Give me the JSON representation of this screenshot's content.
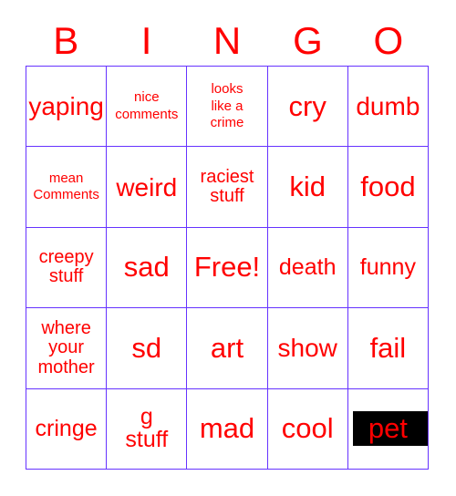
{
  "card": {
    "title": "BINGO",
    "header_letters": [
      "B",
      "I",
      "N",
      "G",
      "O"
    ],
    "colors": {
      "text": "#ff0000",
      "grid_border": "#6633ff",
      "cell_background": "#ffffff",
      "marked_highlight": "#000000",
      "page_background": "#ffffff"
    },
    "rows": [
      [
        {
          "label": "yaping",
          "size": "lg",
          "marked": false
        },
        {
          "label": "nice\ncomments",
          "size": "xs",
          "marked": false
        },
        {
          "label": "looks\nlike a\ncrime",
          "size": "xs",
          "marked": false
        },
        {
          "label": "cry",
          "size": "xl",
          "marked": false
        },
        {
          "label": "dumb",
          "size": "lg",
          "marked": false
        }
      ],
      [
        {
          "label": "mean\nComments",
          "size": "xs",
          "marked": false
        },
        {
          "label": "weird",
          "size": "lg",
          "marked": false
        },
        {
          "label": "raciest\nstuff",
          "size": "sm",
          "marked": false
        },
        {
          "label": "kid",
          "size": "xl",
          "marked": false
        },
        {
          "label": "food",
          "size": "xl",
          "marked": false
        }
      ],
      [
        {
          "label": "creepy\nstuff",
          "size": "sm",
          "marked": false
        },
        {
          "label": "sad",
          "size": "xl",
          "marked": false
        },
        {
          "label": "Free!",
          "size": "xl",
          "marked": false
        },
        {
          "label": "death",
          "size": "md",
          "marked": false
        },
        {
          "label": "funny",
          "size": "md",
          "marked": false
        }
      ],
      [
        {
          "label": "where\nyour\nmother",
          "size": "sm",
          "marked": false
        },
        {
          "label": "sd",
          "size": "xl",
          "marked": false
        },
        {
          "label": "art",
          "size": "xl",
          "marked": false
        },
        {
          "label": "show",
          "size": "lg",
          "marked": false
        },
        {
          "label": "fail",
          "size": "xl",
          "marked": false
        }
      ],
      [
        {
          "label": "cringe",
          "size": "md",
          "marked": false
        },
        {
          "label": "g\nstuff",
          "size": "md",
          "marked": false
        },
        {
          "label": "mad",
          "size": "xl",
          "marked": false
        },
        {
          "label": "cool",
          "size": "xl",
          "marked": false
        },
        {
          "label": "pet",
          "size": "xl",
          "marked": true
        }
      ]
    ]
  }
}
